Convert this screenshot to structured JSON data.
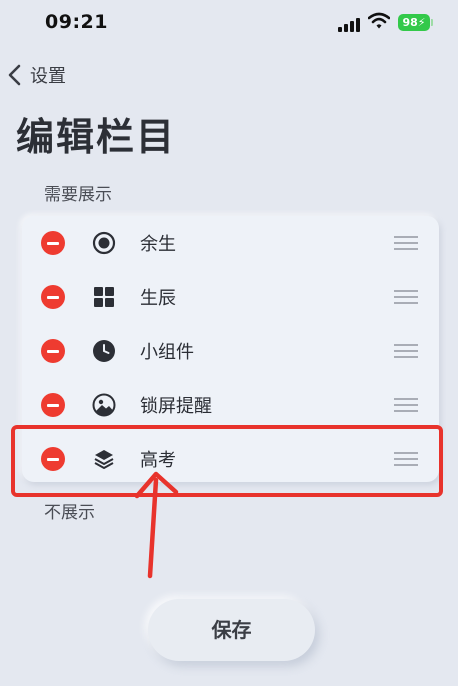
{
  "status_bar": {
    "time": "09:21",
    "battery": "98"
  },
  "nav": {
    "back_label": "设置"
  },
  "page": {
    "title": "编辑栏目"
  },
  "sections": {
    "shown_label": "需要展示",
    "hidden_label": "不展示"
  },
  "items": [
    {
      "label": "余生",
      "icon": "radio-target-icon"
    },
    {
      "label": "生辰",
      "icon": "grid-icon"
    },
    {
      "label": "小组件",
      "icon": "clock-icon"
    },
    {
      "label": "锁屏提醒",
      "icon": "image-icon"
    },
    {
      "label": "高考",
      "icon": "layers-icon"
    }
  ],
  "actions": {
    "save_label": "保存"
  },
  "colors": {
    "remove": "#ee3b30",
    "highlight": "#e8332c",
    "battery": "#33c94a"
  }
}
